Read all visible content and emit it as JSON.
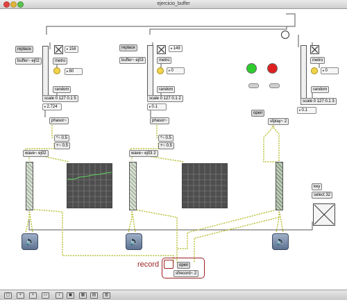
{
  "window": {
    "title": "ejercicio_buffer"
  },
  "modules": [
    {
      "replace": "replace",
      "buffer": "buffer~ ej02",
      "metro_val": "158",
      "metro": "metro",
      "ms": "80",
      "random": "random",
      "scale": "scale 0 127 0.1 5",
      "freq": "2.724",
      "phasor": "phasor~",
      "mul": "*~ 0.5",
      "add": "+~ 0.5",
      "wave": "wave~ ej02"
    },
    {
      "replace": "replace",
      "buffer": "buffer~ ej03",
      "metro_val": "149",
      "metro": "metro",
      "ms": "0",
      "random": "random",
      "scale": "scale 0 127 0.1 2",
      "freq": "0.1",
      "phasor": "phasor~",
      "mul": "*~ 0.5",
      "add": "+~ 0.5",
      "wave": "wave~ ej03 2"
    },
    {
      "metro": "metro",
      "ms": "0",
      "random": "random",
      "scale": "scale 0 127 0.1 3",
      "freq": "0.1",
      "open": "open",
      "sfplay": "sfplay~ 2"
    }
  ],
  "transport": {
    "led_play_color": "#2ecc2e",
    "led_stop_color": "#e02020"
  },
  "keys": {
    "key": "key",
    "select": "select 32"
  },
  "record": {
    "label": "record",
    "open": "open",
    "sfrecord": "sfrecord~ 2",
    "accent": "#9a1f1f"
  },
  "icons": [
    "toggle-x-icon",
    "bang-icon",
    "speaker-icon",
    "lock-icon",
    "grid-icon"
  ]
}
